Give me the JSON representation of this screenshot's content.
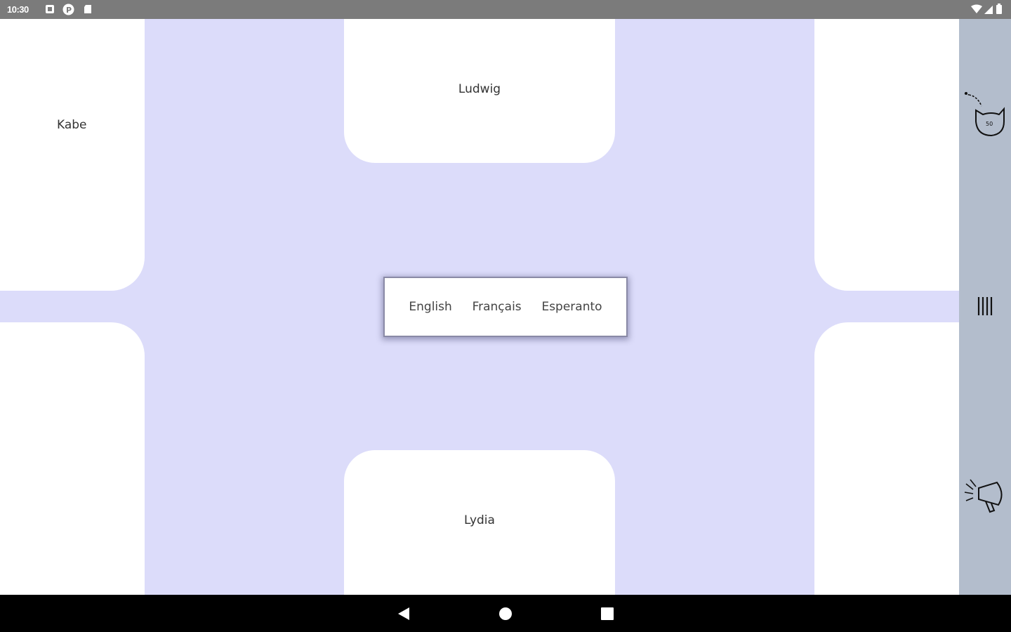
{
  "status_bar": {
    "time": "10:30",
    "icons": [
      "stop-square-icon",
      "p-circle-icon",
      "sd-card-icon",
      "wifi-icon",
      "signal-icon",
      "battery-icon"
    ],
    "background": "#7b7b7b"
  },
  "board": {
    "background": "#dcdcfa",
    "cards": {
      "left_top": "Kabe",
      "top": "Ludwig",
      "bottom": "Lydia"
    }
  },
  "language_selector": {
    "options": [
      "English",
      "Français",
      "Esperanto"
    ]
  },
  "side_panel": {
    "background": "#b3bdcc",
    "icons": [
      "cat-alarm-icon",
      "tally-marks-icon",
      "megaphone-icon"
    ],
    "cat_label": "50"
  },
  "nav_bar": {
    "buttons": [
      "back-icon",
      "home-icon",
      "recents-icon"
    ]
  }
}
